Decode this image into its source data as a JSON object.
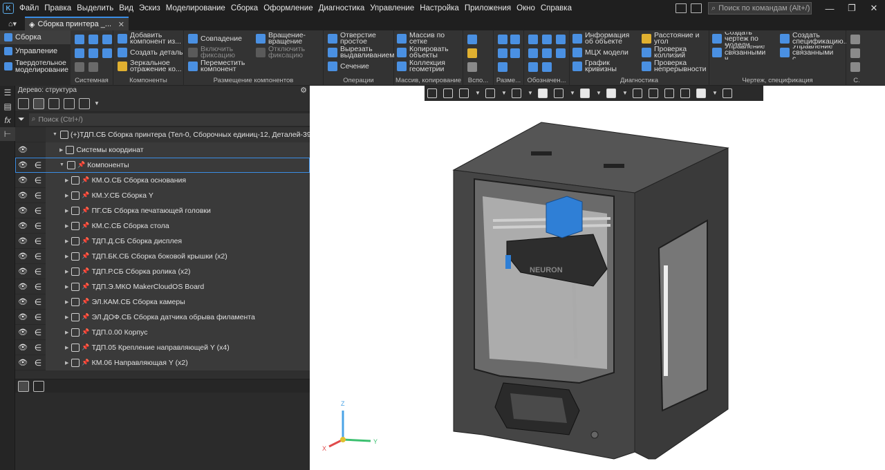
{
  "menu": {
    "items": [
      "Файл",
      "Правка",
      "Выделить",
      "Вид",
      "Эскиз",
      "Моделирование",
      "Сборка",
      "Оформление",
      "Диагностика",
      "Управление",
      "Настройка",
      "Приложения",
      "Окно",
      "Справка"
    ],
    "search_placeholder": "Поиск по командам (Alt+/)"
  },
  "tab": {
    "title": "Сборка принтера _..."
  },
  "modes": [
    "Сборка",
    "Управление",
    "Твердотельное моделирование"
  ],
  "ribbon": {
    "groups": {
      "system": "Системная",
      "components": "Компоненты",
      "placement": "Размещение компонентов",
      "operations": "Операции",
      "arrays": "Массив, копирование",
      "dims": "Разме...",
      "designations": "Обозначен...",
      "diagnostics": "Диагностика",
      "drawing": "Чертеж, спецификация",
      "aux": "Вспо...",
      "s": "С."
    },
    "buttons": {
      "add_component": "Добавить компонент из...",
      "create_detail": "Создать деталь",
      "mirror": "Зеркальное отражение ко...",
      "coincidence": "Совпадение",
      "enable_fix": "Включить фиксацию",
      "move_component": "Переместить компонент",
      "rotation": "Вращение-вращение",
      "disable_fix": "Отключить фиксацию",
      "hole": "Отверстие простое",
      "cut_extrude": "Вырезать выдавливанием",
      "section": "Сечение",
      "grid_array": "Массив по сетке",
      "copy_objects": "Копировать объекты",
      "geom_collection": "Коллекция геометрии",
      "object_info": "Информация об объекте",
      "mass_props": "МЦХ модели",
      "curvature": "График кривизны",
      "distance_angle": "Расстояние и угол",
      "collisions": "Проверка коллизий",
      "continuity": "Проверка непрерывности",
      "create_drawing": "Создать чертеж по модели",
      "manage_linked_1": "Управление связанными ч...",
      "create_spec": "Создать спецификацию...",
      "manage_linked_2": "Управление связанными с..."
    }
  },
  "tree": {
    "title": "Дерево: структура",
    "search_placeholder": "Поиск (Ctrl+/)",
    "rows": [
      "(+)ТДП.СБ Сборка принтера (Тел-0, Сборочных единиц-12, Деталей-395)",
      "Системы координат",
      "Компоненты",
      "КМ.О.СБ Сборка основания",
      "КМ.У.СБ Сборка Y",
      "ПГ.СБ Сборка печатающей головки",
      "КМ.С.СБ Сборка стола",
      "ТДП.Д.СБ Сборка дисплея",
      "ТДП.БК.СБ Сборка боковой крышки (x2)",
      "ТДП.Р.СБ Сборка ролика (x2)",
      "ТДП.Э.МКО MakerCloudOS Board",
      "ЭЛ.КАМ.СБ Сборка камеры",
      "ЭЛ.ДОФ.СБ Сборка датчика обрыва филамента",
      "ТДП.0.00 Корпус",
      "ТДП.05 Крепление направляющей Y (x4)",
      "КМ.06 Направляющая Y (x2)"
    ]
  },
  "viewport": {
    "brand_label": "NEURON",
    "axes": {
      "x": "X",
      "y": "Y",
      "z": "Z"
    }
  },
  "colors": {
    "accent": "#3a8ee6",
    "head": "#2f7fd6",
    "body": "#3c3c3c"
  }
}
